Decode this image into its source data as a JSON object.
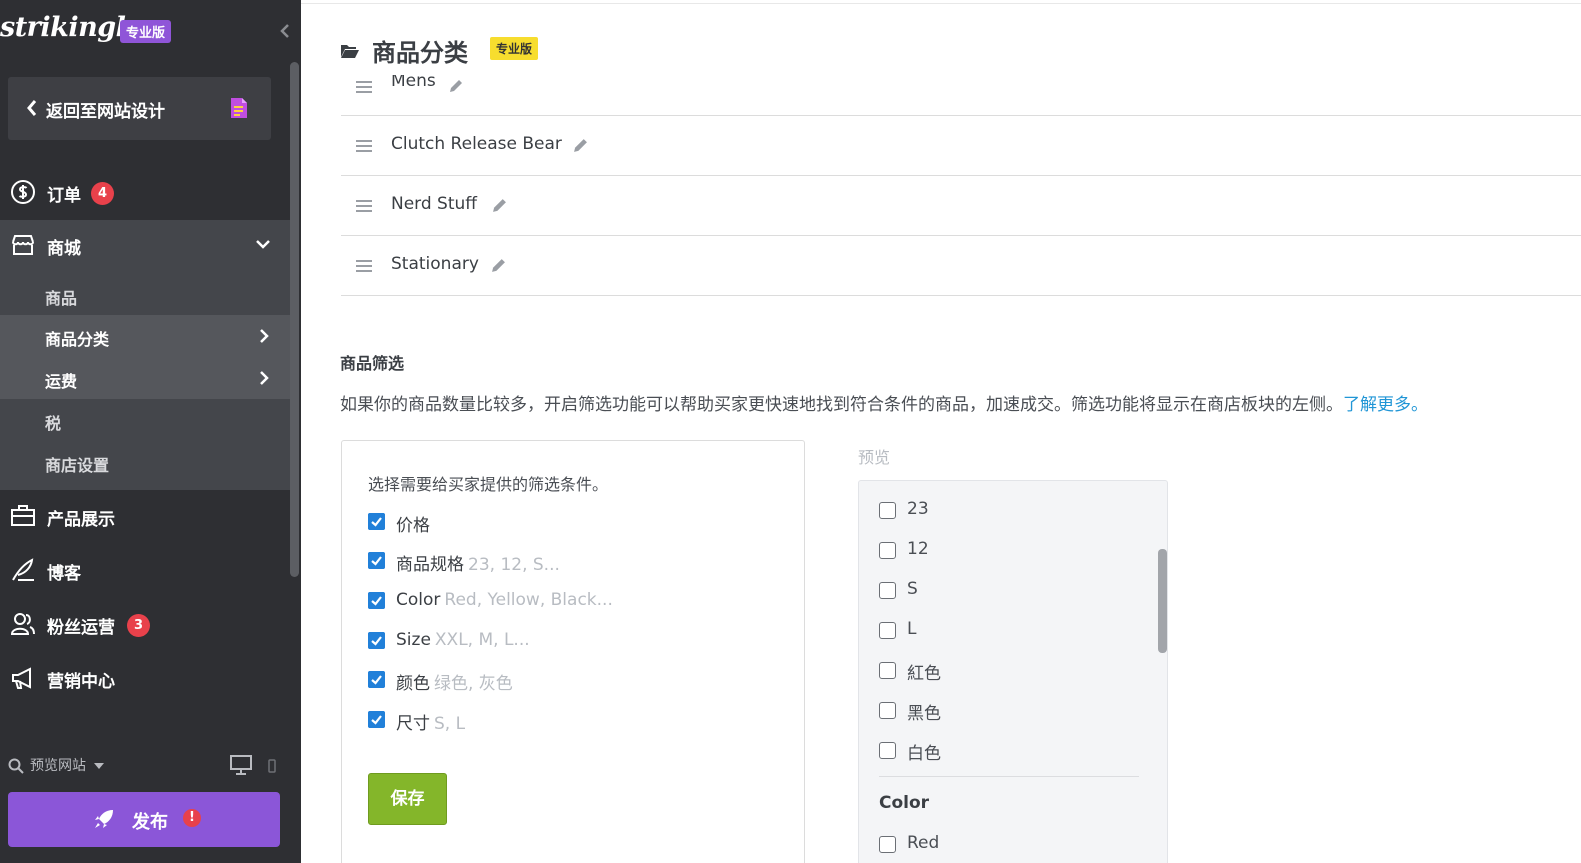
{
  "sidebar": {
    "logo": "strikingly",
    "pro_badge": "专业版",
    "back_label": "返回至网站设计",
    "nav": [
      {
        "label": "订单",
        "badge": "4"
      },
      {
        "label": "商城"
      },
      {
        "label": "产品展示"
      },
      {
        "label": "博客"
      },
      {
        "label": "粉丝运营",
        "badge": "3"
      },
      {
        "label": "营销中心"
      }
    ],
    "shop_sub": [
      {
        "label": "商品"
      },
      {
        "label": "商品分类"
      },
      {
        "label": "运费"
      },
      {
        "label": "税"
      },
      {
        "label": "商店设置"
      }
    ],
    "preview_site": "预览网站",
    "publish": "发布",
    "publish_warn": "!"
  },
  "main": {
    "title": "商品分类",
    "title_badge": "专业版",
    "categories": [
      {
        "name": "Mens"
      },
      {
        "name": "Clutch Release Bear"
      },
      {
        "name": "Nerd Stuff"
      },
      {
        "name": "Stationary"
      }
    ],
    "filter": {
      "title": "商品筛选",
      "description": "如果你的商品数量比较多，开启筛选功能可以帮助买家更快速地找到符合条件的商品，加速成交。筛选功能将显示在商店板块的左侧。",
      "learn_more": "了解更多。",
      "hint": "选择需要给买家提供的筛选条件。",
      "options": [
        {
          "label": "价格",
          "values": ""
        },
        {
          "label": "商品规格",
          "values": "23, 12, S..."
        },
        {
          "label": "Color",
          "values": "Red, Yellow, Black..."
        },
        {
          "label": "Size",
          "values": "XXL, M, L..."
        },
        {
          "label": "颜色",
          "values": "绿色, 灰色"
        },
        {
          "label": "尺寸",
          "values": "S, L"
        }
      ],
      "save": "保存"
    },
    "preview": {
      "label": "预览",
      "items": [
        "23",
        "12",
        "S",
        "L",
        "紅色",
        "黑色",
        "白色"
      ],
      "group_label": "Color",
      "group_items": [
        "Red"
      ]
    }
  },
  "colors": {
    "sidebar_bg": "#2e2f33",
    "accent_purple": "#8b56d8",
    "checkbox_blue": "#2180d9",
    "save_green": "#84b62a",
    "link_blue": "#2196d6",
    "badge_red": "#e8414b",
    "pro_yellow": "#f7dd2e"
  }
}
